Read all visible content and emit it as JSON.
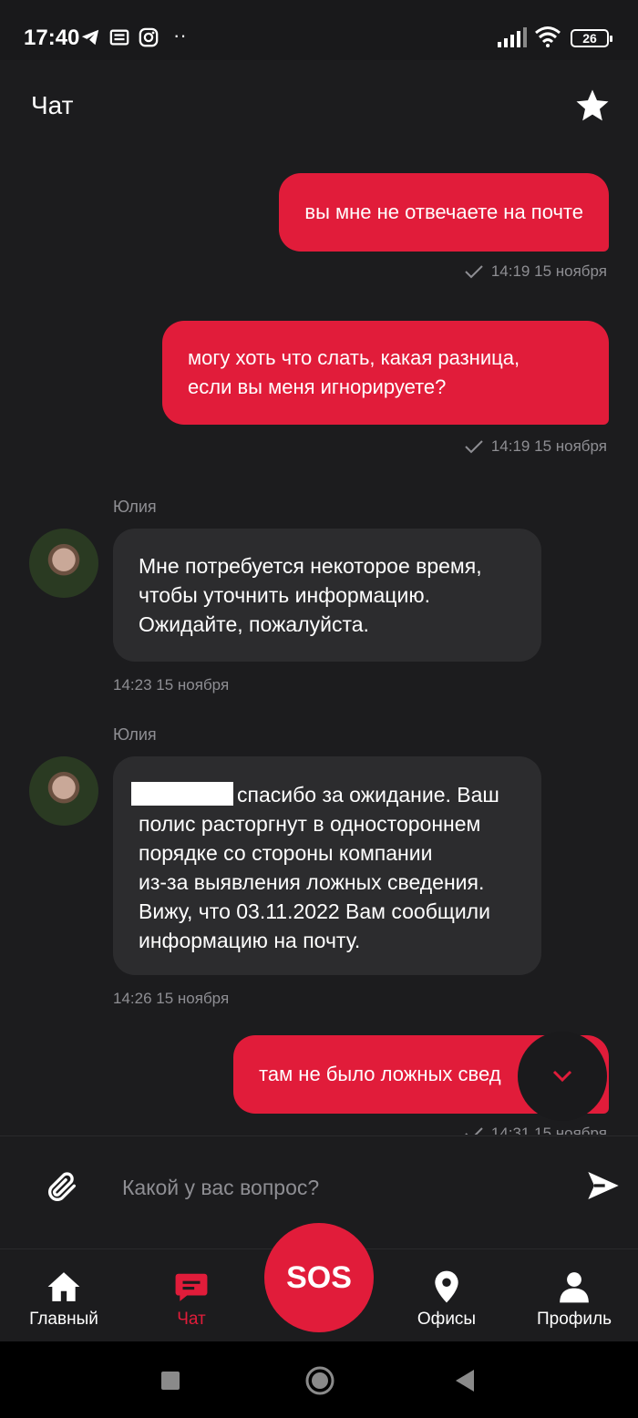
{
  "status": {
    "time": "17:40",
    "battery": "26"
  },
  "header": {
    "title": "Чат"
  },
  "messages": [
    {
      "dir": "out",
      "text": "вы мне не отвечаете на почте",
      "time": "14:19 15 ноября"
    },
    {
      "dir": "out",
      "lines": [
        "могу хоть что слать, какая разница,",
        "если вы меня игнорируете?"
      ],
      "time": "14:19 15 ноября"
    },
    {
      "dir": "in",
      "sender": "Юлия",
      "lines": [
        "Мне потребуется некоторое время,",
        "чтобы уточнить информацию.",
        "Ожидайте, пожалуйста."
      ],
      "time": "14:23 15 ноября"
    },
    {
      "dir": "in",
      "sender": "Юлия",
      "lines": [
        "спасибо за ожидание. Ваш",
        "полис расторгнут в одностороннем",
        "порядке со стороны компании",
        "из-за выявления ложных сведения.",
        "Вижу, что 03.11.2022 Вам сообщили",
        "информацию на почту."
      ],
      "time": "14:26 15 ноября"
    },
    {
      "dir": "out",
      "text": "там не было ложных свед",
      "time": "14:31 15 ноября"
    }
  ],
  "input": {
    "placeholder": "Какой у вас вопрос?"
  },
  "nav": {
    "home": "Главный",
    "chat": "Чат",
    "sos": "SOS",
    "offices": "Офисы",
    "profile": "Профиль"
  },
  "colors": {
    "accent": "#e11c3a",
    "background": "#1c1c1e",
    "bubble_in": "#2c2c2e",
    "meta": "#8e8e93"
  },
  "icons": [
    "telegram-icon",
    "news-icon",
    "instagram-icon",
    "signal-icon",
    "wifi-icon",
    "star-icon",
    "check-icon",
    "chevron-down-icon",
    "paperclip-icon",
    "send-icon",
    "home-icon",
    "chat-icon",
    "location-pin-icon",
    "person-icon",
    "square-icon",
    "circle-icon",
    "back-triangle-icon"
  ]
}
